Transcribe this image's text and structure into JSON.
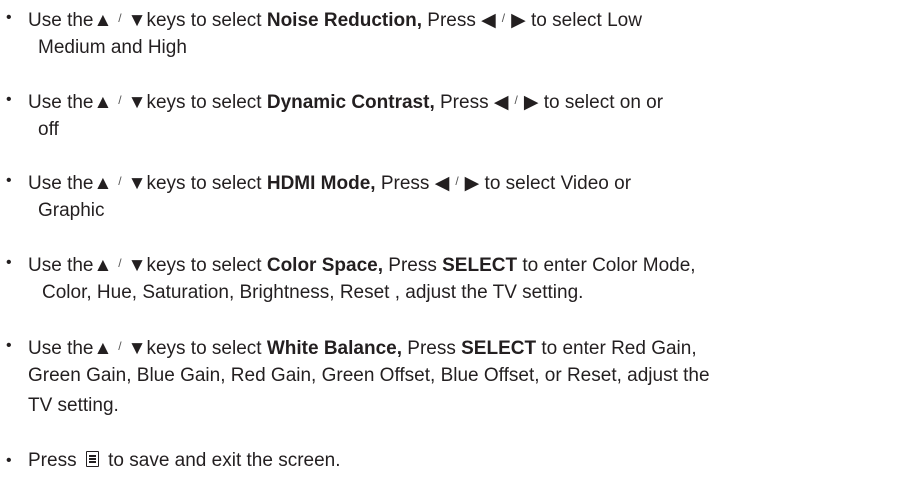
{
  "items": [
    {
      "lines": [
        [
          "Use the",
          "{arrows_ud}",
          "keys to select ",
          "**Noise Reduction,**",
          " Press ",
          "{arrows_lr}",
          " to select Low"
        ],
        [
          "Medium and High"
        ]
      ]
    },
    {
      "lines": [
        [
          "Use the",
          "{arrows_ud}",
          "keys to select ",
          "**Dynamic Contrast,**",
          " Press ",
          "{arrows_lr}",
          " to select  on or"
        ],
        [
          "off"
        ]
      ]
    },
    {
      "lines": [
        [
          "Use the",
          "{arrows_ud}",
          "keys to select ",
          "**HDMI Mode,**",
          " Press ",
          "{arrows_lr}",
          " to select  Video or"
        ],
        [
          "Graphic"
        ]
      ]
    },
    {
      "lines": [
        [
          "Use the",
          "{arrows_ud}",
          "keys to select ",
          "**Color Space,**",
          " Press  ",
          "**SELECT**",
          "  to enter Color Mode,"
        ],
        [
          "Color, Hue, Saturation, Brightness, Reset , adjust the TV setting."
        ]
      ]
    },
    {
      "lines": [
        [
          "Use the",
          "{arrows_ud}",
          "keys to select ",
          "**White Balance,**",
          " Press  ",
          "**SELECT**",
          "  to enter Red Gain,"
        ],
        [
          "Green Gain, Blue Gain, Red Gain, Green Offset, Blue Offset, or Reset, adjust the"
        ],
        [
          "TV setting."
        ]
      ]
    },
    {
      "lines": [
        [
          "Press ",
          "{menu_icon}",
          " to save and exit the screen."
        ]
      ]
    }
  ],
  "bullet_char": "•",
  "symbols": {
    "up": "▲",
    "down": "▼",
    "left": "◀",
    "right": "▶",
    "slash": "/"
  }
}
